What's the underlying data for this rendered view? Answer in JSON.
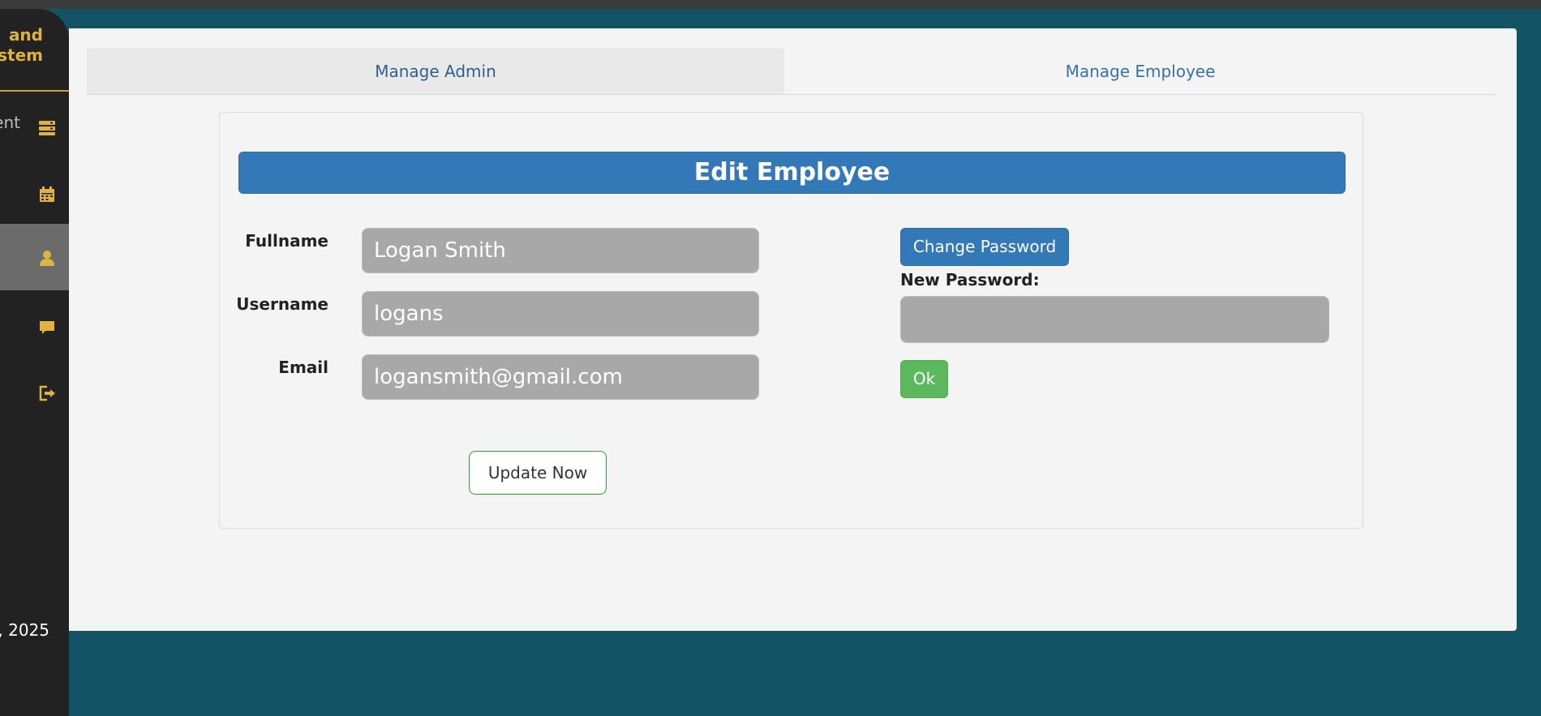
{
  "sidebar": {
    "brand_line1": "and",
    "brand_line2": "ystem",
    "items": [
      {
        "label": "ent",
        "icon": "server-icon",
        "active": false
      },
      {
        "label": "",
        "icon": "calendar-icon",
        "active": false
      },
      {
        "label": "",
        "icon": "user-icon",
        "active": true
      },
      {
        "label": "",
        "icon": "comment-icon",
        "active": false
      },
      {
        "label": "",
        "icon": "logout-icon",
        "active": false
      }
    ],
    "date_text": ", 2025"
  },
  "tabs": [
    {
      "label": "Manage Admin"
    },
    {
      "label": "Manage Employee"
    }
  ],
  "form": {
    "title": "Edit Employee",
    "fullname_label": "Fullname",
    "fullname_value": "Logan Smith",
    "username_label": "Username",
    "username_value": "logans",
    "email_label": "Email",
    "email_value": "logansmith@gmail.com",
    "update_button": "Update Now",
    "change_password_button": "Change Password",
    "new_password_label": "New Password:",
    "new_password_value": "",
    "ok_button": "Ok"
  },
  "colors": {
    "background": "#125366",
    "sidebar": "#222222",
    "accent_gold": "#e0b33c",
    "primary": "#3379b7",
    "success": "#5cb85c",
    "field_bg": "#a8a8a8"
  }
}
